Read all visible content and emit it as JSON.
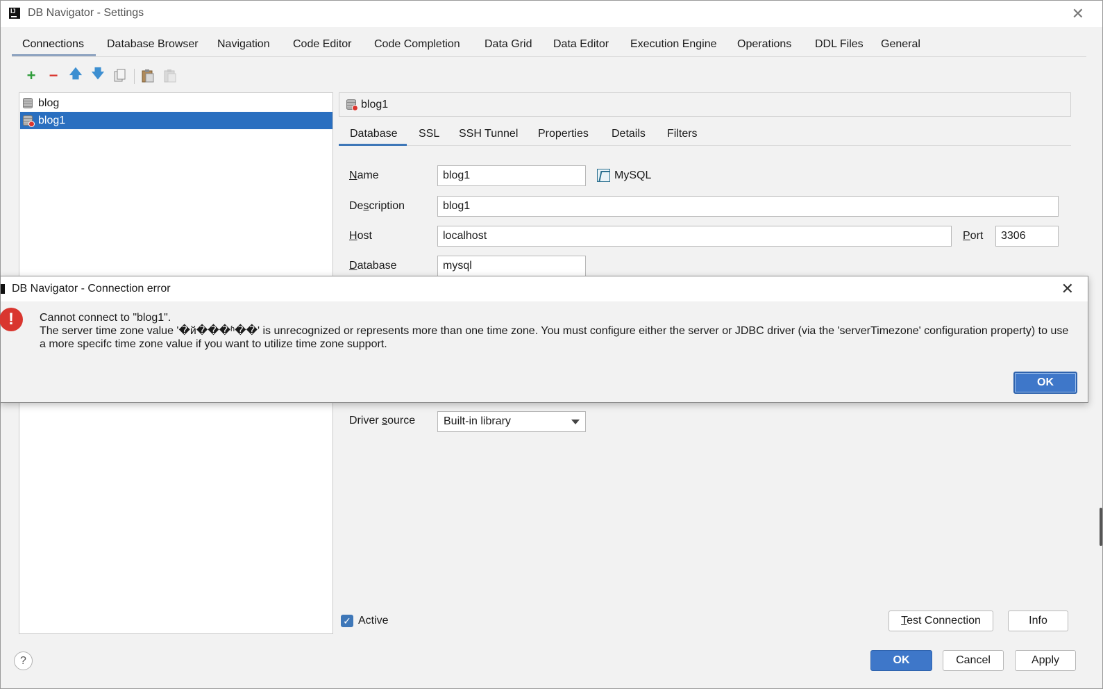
{
  "window": {
    "title": "DB Navigator - Settings",
    "close_icon": "close-icon"
  },
  "top_tabs": [
    {
      "label": "Connections",
      "active": true
    },
    {
      "label": "Database Browser"
    },
    {
      "label": "Navigation"
    },
    {
      "label": "Code Editor"
    },
    {
      "label": "Code Completion"
    },
    {
      "label": "Data Grid"
    },
    {
      "label": "Data Editor"
    },
    {
      "label": "Execution Engine"
    },
    {
      "label": "Operations"
    },
    {
      "label": "DDL Files"
    },
    {
      "label": "General"
    }
  ],
  "toolbar": {
    "icons": [
      "add-icon",
      "remove-icon",
      "move-up-icon",
      "move-down-icon",
      "copy-icon",
      "paste-icon",
      "paste-disabled-icon"
    ]
  },
  "connections": {
    "items": [
      {
        "label": "blog",
        "selected": false
      },
      {
        "label": "blog1",
        "selected": true
      }
    ]
  },
  "connection_header": {
    "name": "blog1"
  },
  "sub_tabs": [
    {
      "label": "Database",
      "active": true
    },
    {
      "label": "SSL"
    },
    {
      "label": "SSH Tunnel"
    },
    {
      "label": "Properties"
    },
    {
      "label": "Details"
    },
    {
      "label": "Filters"
    }
  ],
  "form": {
    "name_label_first": "N",
    "name_label_rest": "ame",
    "name_value": "blog1",
    "database_type": "MySQL",
    "description_label_a": "De",
    "description_label_u": "s",
    "description_label_b": "cription",
    "description_value": "blog1",
    "host_label_first": "H",
    "host_label_rest": "ost",
    "host_value": "localhost",
    "port_label_first": "P",
    "port_label_rest": "ort",
    "port_value": "3306",
    "database_label_first": "D",
    "database_label_rest": "atabase",
    "database_value": "mysql",
    "driver_source_label_a": "Driver ",
    "driver_source_label_u": "s",
    "driver_source_label_b": "ource",
    "driver_source_value": "Built-in library",
    "active_label": "Active",
    "active_checked": true
  },
  "buttons": {
    "test_connection_first": "T",
    "test_connection_rest": "est Connection",
    "info": "Info",
    "ok": "OK",
    "cancel": "Cancel",
    "apply": "Apply",
    "help": "?"
  },
  "dialog": {
    "title": "DB Navigator - Connection error",
    "line1": "Cannot connect to \"blog1\".",
    "line2": "The server time zone value '�й���ʱ��' is unrecognized or represents more than one time zone. You must configure either the server or JDBC driver (via the 'serverTimezone' configuration property) to use a more specifc time zone value if you want to utilize time zone support.",
    "ok": "OK",
    "icon": "error-icon"
  },
  "colors": {
    "selection": "#2a6fc0",
    "primary_button": "#3e77c9",
    "error": "#d9362f",
    "add_icon": "#2e9c3a",
    "remove_icon": "#d9362f",
    "arrow_icon": "#3d8fd1"
  }
}
